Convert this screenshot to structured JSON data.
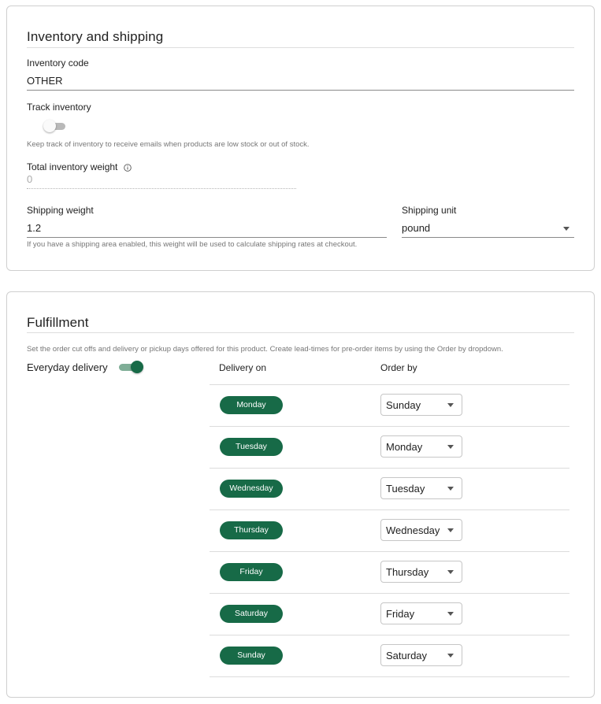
{
  "inventory_card": {
    "title": "Inventory and shipping",
    "inventory_code_label": "Inventory code",
    "inventory_code_value": "OTHER",
    "track_inventory_label": "Track inventory",
    "track_inventory_on": false,
    "track_inventory_helper": "Keep track of inventory to receive emails when products are low stock or out of stock.",
    "total_weight_label": "Total inventory weight",
    "total_weight_value": "0",
    "shipping_weight_label": "Shipping weight",
    "shipping_weight_value": "1.2",
    "shipping_weight_helper": "If you have a shipping area enabled, this weight will be used to calculate shipping rates at checkout.",
    "shipping_unit_label": "Shipping unit",
    "shipping_unit_value": "pound"
  },
  "fulfillment_card": {
    "title": "Fulfillment",
    "description": "Set the order cut offs and delivery or pickup days offered for this product. Create lead-times for pre-order items by using the Order by dropdown.",
    "everyday_delivery_label": "Everyday delivery",
    "everyday_delivery_on": true,
    "columns": {
      "delivery_on": "Delivery on",
      "order_by": "Order by"
    },
    "rows": [
      {
        "delivery_day": "Monday",
        "order_by": "Sunday"
      },
      {
        "delivery_day": "Tuesday",
        "order_by": "Monday"
      },
      {
        "delivery_day": "Wednesday",
        "order_by": "Tuesday"
      },
      {
        "delivery_day": "Thursday",
        "order_by": "Wednesday"
      },
      {
        "delivery_day": "Friday",
        "order_by": "Thursday"
      },
      {
        "delivery_day": "Saturday",
        "order_by": "Friday"
      },
      {
        "delivery_day": "Sunday",
        "order_by": "Saturday"
      }
    ]
  },
  "colors": {
    "accent": "#176a47",
    "accent_light": "#7fae97",
    "border": "#cfcfcf"
  },
  "icons": {
    "info": "info-icon",
    "dropdown": "chevron-down-icon"
  }
}
